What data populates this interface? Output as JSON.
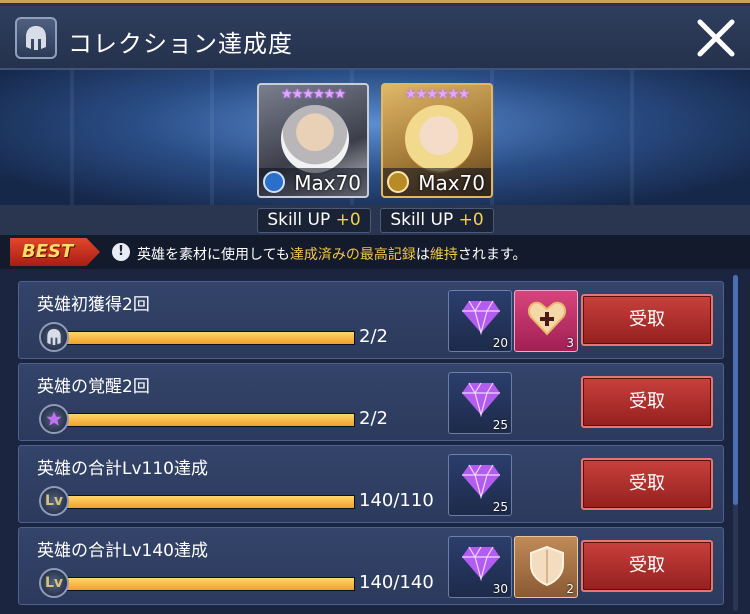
{
  "header": {
    "title": "コレクション達成度",
    "icon": "helmet-icon",
    "close_icon": "close-icon"
  },
  "heroes": [
    {
      "stars": "★★★★★★",
      "level": "Max70",
      "class_icon": "shield-class-icon"
    },
    {
      "stars": "★★★★★★",
      "level": "Max70",
      "class_icon": "sword-class-icon"
    }
  ],
  "skill_up": [
    {
      "label": "Skill UP ",
      "value": "+0"
    },
    {
      "label": "Skill UP ",
      "value": "+0"
    }
  ],
  "best": {
    "tag": "BEST",
    "info_icon": "!",
    "text_a": "英雄を素材に使用しても",
    "text_hl1": "達成済みの最高記録",
    "text_b": "は",
    "text_hl2": "維持",
    "text_c": "されます。"
  },
  "missions": [
    {
      "title": "英雄初獲得2回",
      "badge_icon": "helmet-icon",
      "progress_text": "2/2",
      "progress": 1.0,
      "rewards": [
        {
          "type": "gem",
          "qty": "20"
        },
        {
          "type": "potion",
          "qty": "3"
        }
      ],
      "claim_label": "受取"
    },
    {
      "title": "英雄の覚醒2回",
      "badge_icon": "star-icon",
      "progress_text": "2/2",
      "progress": 1.0,
      "rewards": [
        {
          "type": "gem",
          "qty": "25"
        }
      ],
      "claim_label": "受取"
    },
    {
      "title": "英雄の合計Lv110達成",
      "badge_icon": "lv-icon",
      "badge_text": "Lv",
      "progress_text": "140/110",
      "progress": 1.0,
      "rewards": [
        {
          "type": "gem",
          "qty": "25"
        }
      ],
      "claim_label": "受取"
    },
    {
      "title": "英雄の合計Lv140達成",
      "badge_icon": "lv-icon",
      "badge_text": "Lv",
      "progress_text": "140/140",
      "progress": 1.0,
      "rewards": [
        {
          "type": "gem",
          "qty": "30"
        },
        {
          "type": "shield",
          "qty": "2"
        }
      ],
      "claim_label": "受取"
    }
  ]
}
